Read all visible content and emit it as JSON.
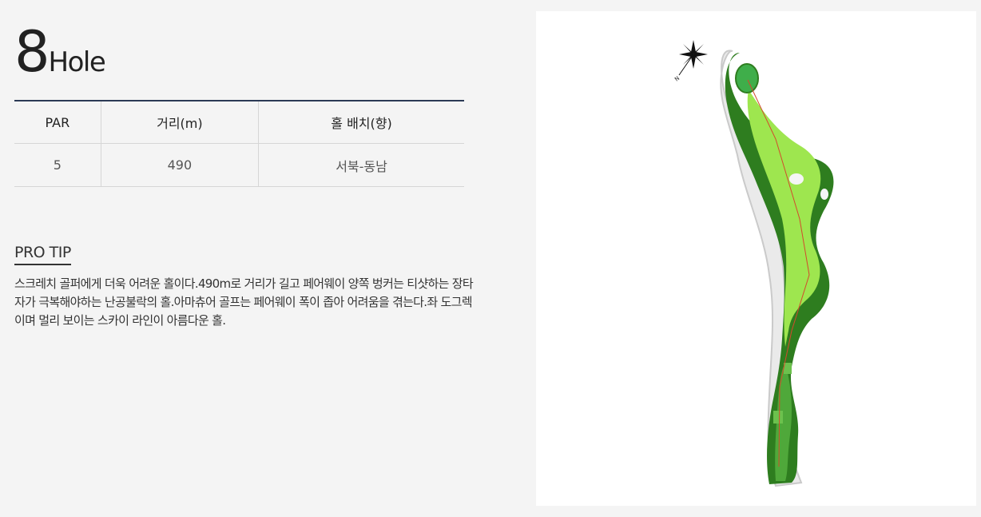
{
  "hole": {
    "number": "8",
    "word": "Hole"
  },
  "table": {
    "headers": [
      "PAR",
      "거리(m)",
      "홀 배치(향)"
    ],
    "values": [
      "5",
      "490",
      "서북-동남"
    ]
  },
  "tip": {
    "heading": "PRO TIP",
    "text": "스크레치 골퍼에게 더욱 어려운 홀이다.490m로 거리가 길고 페어웨이 양쪽 벙커는 티샷하는 장타자가 극복해야하는 난공불락의 홀.아마츄어 골프는 페어웨이 폭이 좁아 어려움을 겪는다.좌 도그렉이며 멀리 보이는 스카이 라인이 아름다운 홀."
  },
  "compass_label": "N",
  "colors": {
    "rough": "#2e7d1f",
    "fairway": "#9ee64f",
    "green": "#3fae4a",
    "line": "#d34a2c"
  }
}
